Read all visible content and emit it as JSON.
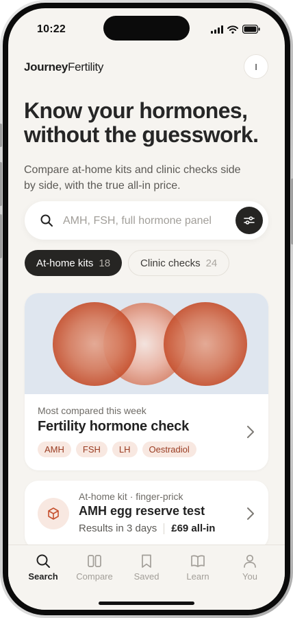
{
  "status_bar": {
    "time": "10:22"
  },
  "brand": {
    "part1": "Journey",
    "part2": "Fertility"
  },
  "avatar": {
    "initial": "I"
  },
  "hero": {
    "headline": "Know your hormones, without the guesswork.",
    "subhead": "Compare at-home kits and clinic checks side by side, with the true all-in price."
  },
  "search": {
    "placeholder": "AMH, FSH, full hormone panel",
    "value": ""
  },
  "tabs": [
    {
      "label": "At-home kits",
      "count": "18",
      "active": true
    },
    {
      "label": "Clinic checks",
      "count": "24",
      "active": false
    }
  ],
  "featured": {
    "kicker": "Most compared this week",
    "title": "Fertility hormone check",
    "tags": [
      "AMH",
      "FSH",
      "LH",
      "Oestradiol"
    ]
  },
  "product": {
    "kicker": "At-home kit · finger-prick",
    "title": "AMH egg reserve test",
    "turnaround": "Results in 3 days",
    "price": "£69 all-in"
  },
  "nav": [
    {
      "label": "Search",
      "icon": "search-icon",
      "active": true
    },
    {
      "label": "Compare",
      "icon": "compare-icon",
      "active": false
    },
    {
      "label": "Saved",
      "icon": "bookmark-icon",
      "active": false
    },
    {
      "label": "Learn",
      "icon": "book-icon",
      "active": false
    },
    {
      "label": "You",
      "icon": "person-icon",
      "active": false
    }
  ],
  "colors": {
    "accent": "#c6512f",
    "dark": "#252422",
    "background": "#f6f4f0",
    "tag_bg": "#f8e8e1"
  }
}
